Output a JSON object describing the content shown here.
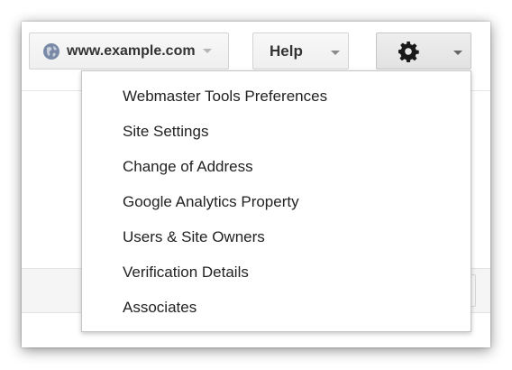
{
  "toolbar": {
    "site": {
      "label": "www.example.com",
      "icon": "globe-icon"
    },
    "help": {
      "label": "Help"
    },
    "settings": {
      "icon": "gear-icon"
    }
  },
  "settings_menu": {
    "items": [
      {
        "label": "Webmaster Tools Preferences"
      },
      {
        "label": "Site Settings"
      },
      {
        "label": "Change of Address"
      },
      {
        "label": "Google Analytics Property"
      },
      {
        "label": "Users & Site Owners"
      },
      {
        "label": "Verification Details"
      },
      {
        "label": "Associates"
      }
    ]
  },
  "colors": {
    "menu_text": "#222222",
    "button_text": "#333333",
    "globe": "#7a8aa6"
  }
}
